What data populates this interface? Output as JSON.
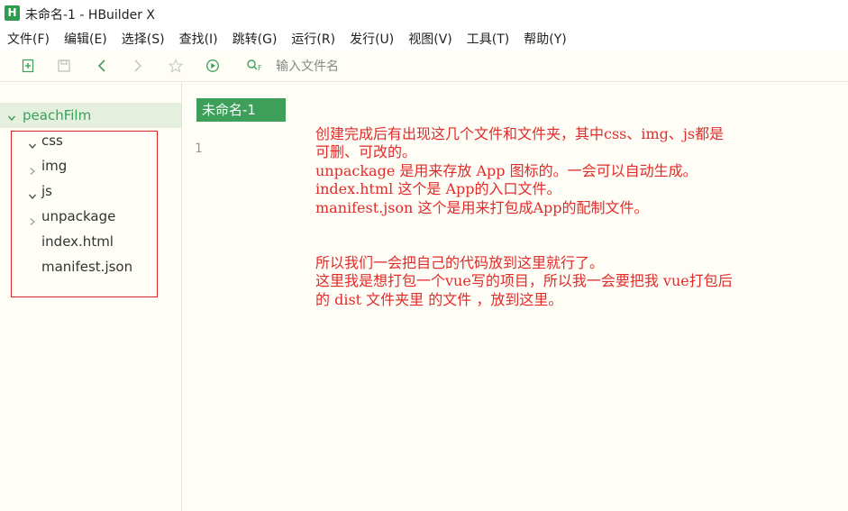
{
  "window": {
    "title": "未命名-1 - HBuilder X",
    "app_icon_letter": "H"
  },
  "menubar": {
    "items": [
      {
        "label": "文件(F)"
      },
      {
        "label": "编辑(E)"
      },
      {
        "label": "选择(S)"
      },
      {
        "label": "查找(I)"
      },
      {
        "label": "跳转(G)"
      },
      {
        "label": "运行(R)"
      },
      {
        "label": "发行(U)"
      },
      {
        "label": "视图(V)"
      },
      {
        "label": "工具(T)"
      },
      {
        "label": "帮助(Y)"
      }
    ]
  },
  "toolbar": {
    "icons": [
      "new-file-icon",
      "save-icon",
      "back-icon",
      "forward-icon",
      "star-icon",
      "run-icon",
      "search-file-icon"
    ],
    "search_placeholder": "输入文件名"
  },
  "sidebar": {
    "project": {
      "name": "peachFilm",
      "expanded": true
    },
    "items": [
      {
        "label": "css",
        "type": "folder",
        "expanded": true
      },
      {
        "label": "img",
        "type": "folder",
        "expanded": false
      },
      {
        "label": "js",
        "type": "folder",
        "expanded": true
      },
      {
        "label": "unpackage",
        "type": "folder",
        "expanded": false
      },
      {
        "label": "index.html",
        "type": "file"
      },
      {
        "label": "manifest.json",
        "type": "file"
      }
    ]
  },
  "editor": {
    "tab_label": "未命名-1",
    "line_number": "1",
    "annotation": {
      "lines_block1": [
        "创建完成后有出现这几个文件和文件夹，其中css、img、js都是",
        "可删、可改的。",
        "unpackage 是用来存放 App 图标的。一会可以自动生成。",
        "index.html  这个是 App的入口文件。",
        "manifest.json 这个是用来打包成App的配制文件。"
      ],
      "lines_block2": [
        "所以我们一会把自己的代码放到这里就行了。",
        "这里我是想打包一个vue写的项目，所以我一会要把我 vue打包后",
        "的 dist 文件夹里 的文件 ，放到这里。"
      ]
    }
  },
  "colors": {
    "accent_green": "#3da05a",
    "annotation_red": "#e02b2b",
    "background_cream": "#fffef6",
    "selection_green": "#e4efdd"
  }
}
